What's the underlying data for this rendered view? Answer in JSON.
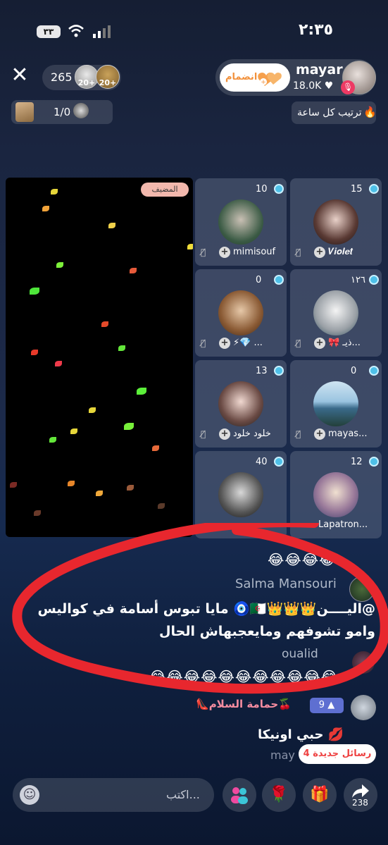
{
  "status_bar": {
    "battery": "٣٣",
    "time": "٢:٣٥"
  },
  "top": {
    "viewer_count": "265",
    "viewer_badges": [
      "20+",
      "20+"
    ],
    "join_label": "انضمام",
    "host_name": "mayar",
    "host_likes": "18.0K ♥",
    "ratio": "1/0",
    "rank_label": "ترتيب كل ساعة"
  },
  "host_tag": "المضيف",
  "seats": [
    {
      "count": "10",
      "name": "mimisouf"
    },
    {
      "count": "15",
      "name": "𝑽𝒊𝒐𝒍𝒆𝒕"
    },
    {
      "count": "0",
      "name": "⚡💎 ..."
    },
    {
      "count": "١٢٦",
      "name": "🎀 ذيـ..."
    },
    {
      "count": "13",
      "name": "خلود خلود"
    },
    {
      "count": "0",
      "name": "mayas..."
    },
    {
      "count": "40",
      "name": ""
    },
    {
      "count": "12",
      "name": "Lapatron..."
    }
  ],
  "chat": {
    "emoji_row1": "😂😂😂😂",
    "salma_name": "Salma Mansouri",
    "salma_msg_line1": "@اليــــن👑👑👑🇩🇿🧿 مايا تبوس أسامة في كواليس",
    "salma_msg_line2": "وامو تشوفهم ومايعجبهاش الحال",
    "oualid_name": "oualid",
    "emoji_row2": "😂😂😂😂😂😂😂😂😂😂😂",
    "hamama_name": "👠حمامة السلام🍒",
    "level": "9",
    "love_msg": "حبي اونيكا 💋",
    "may_name": "may",
    "new_messages": "4 رسائل جديدة"
  },
  "bottom": {
    "input_placeholder": "اكتب...",
    "share_count": "238"
  }
}
